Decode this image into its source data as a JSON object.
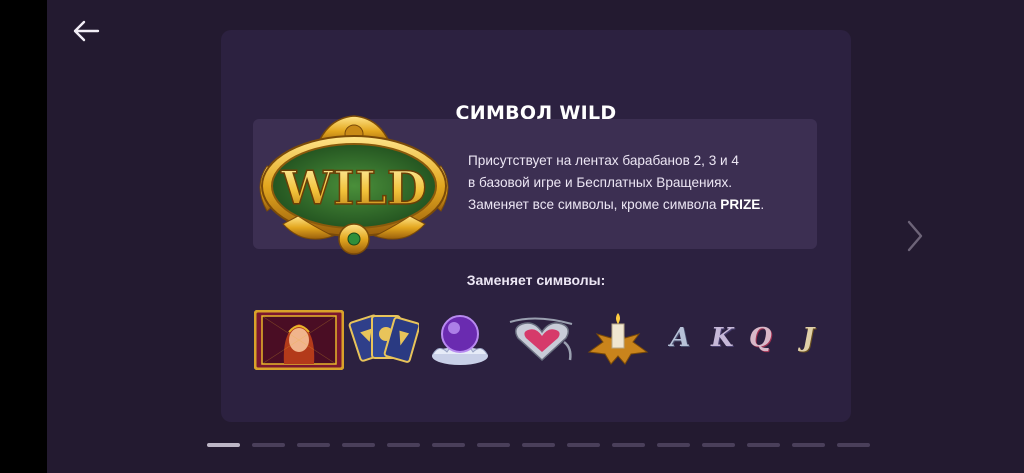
{
  "header": {
    "back_icon": "arrow-left-icon"
  },
  "nav": {
    "next_icon": "chevron-right-icon"
  },
  "panel": {
    "title": "СИМВОЛ WILD",
    "wild_text": "WILD",
    "description": {
      "line1": "Присутствует на лентах барабанов 2, 3 и 4",
      "line2": "в базовой игре и Бесплатных Вращениях.",
      "line3_prefix": "Заменяет все символы, кроме символа ",
      "line3_bold": "PRIZE",
      "line3_suffix": "."
    },
    "replaces_label": "Заменяет символы:",
    "symbols": [
      {
        "name": "fortune-teller-symbol"
      },
      {
        "name": "tarot-cards-symbol"
      },
      {
        "name": "crystal-ball-symbol"
      },
      {
        "name": "heart-amulet-symbol"
      },
      {
        "name": "candle-symbol"
      },
      {
        "name": "letter-a-symbol",
        "letter": "A"
      },
      {
        "name": "letter-k-symbol",
        "letter": "K"
      },
      {
        "name": "letter-q-symbol",
        "letter": "Q"
      },
      {
        "name": "letter-j-symbol",
        "letter": "J"
      }
    ]
  },
  "pager": {
    "total": 15,
    "active": 1
  },
  "colors": {
    "background": "#231a30",
    "panel": "#2c2140",
    "info_box": "#3c2f52",
    "gold": "#e8b52a",
    "green": "#2f6e2a"
  }
}
